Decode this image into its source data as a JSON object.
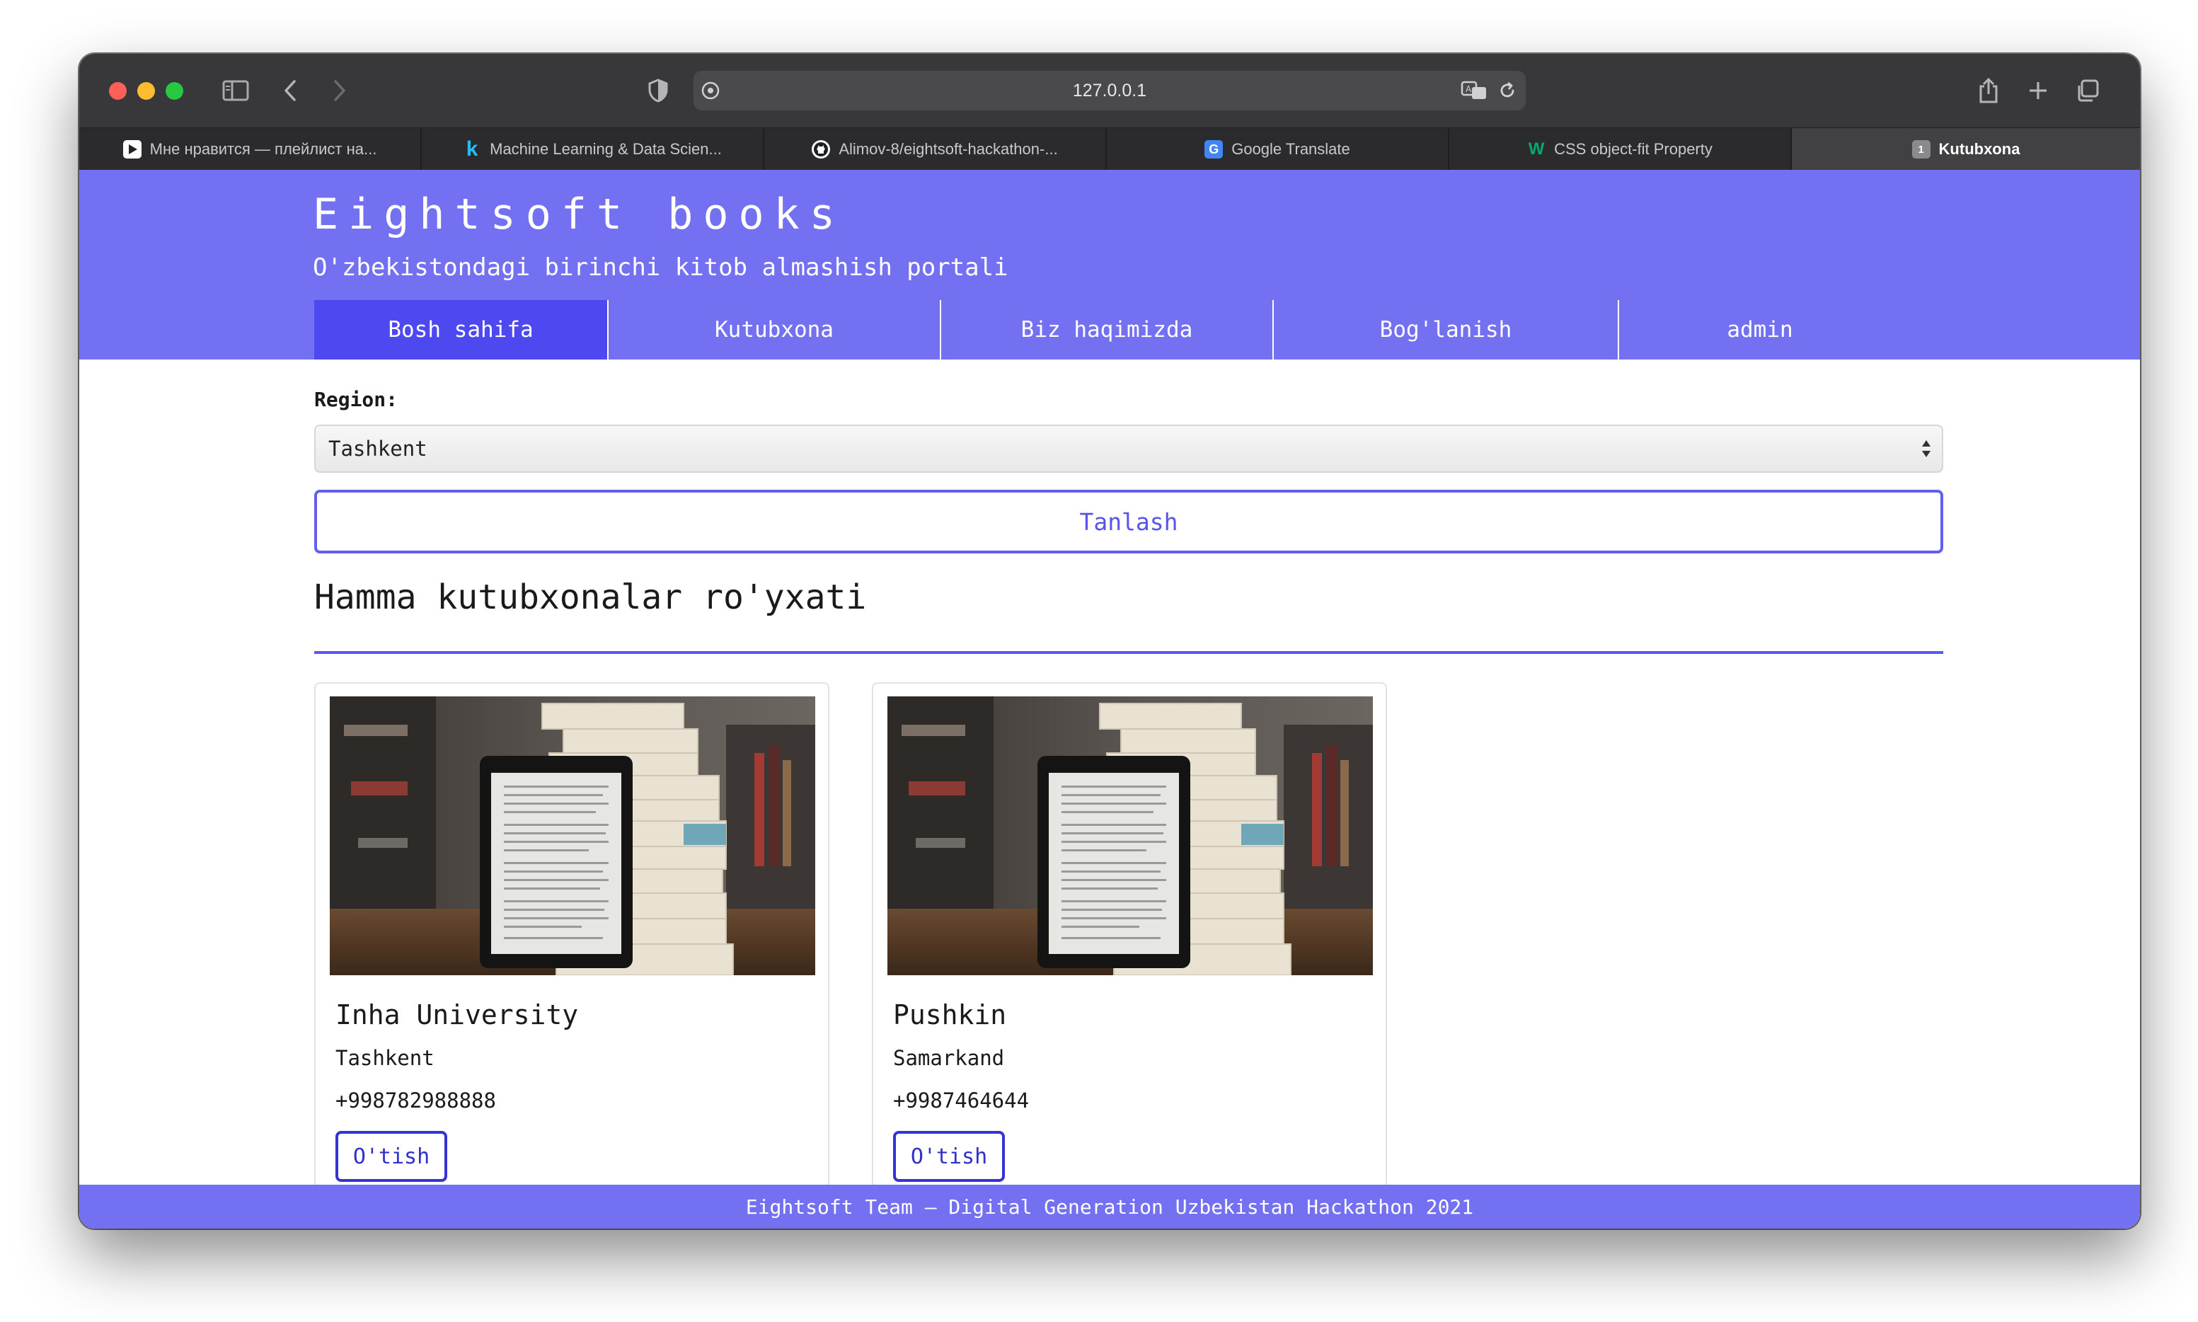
{
  "browser": {
    "url": "127.0.0.1",
    "tabs": [
      {
        "title": "Мне нравится — плейлист на...",
        "icon": "play-icon"
      },
      {
        "title": "Machine Learning & Data Scien...",
        "icon": "kaggle-icon"
      },
      {
        "title": "Alimov-8/eightsoft-hackathon-...",
        "icon": "github-icon"
      },
      {
        "title": "Google Translate",
        "icon": "google-translate-icon"
      },
      {
        "title": "CSS object-fit Property",
        "icon": "w3schools-icon"
      },
      {
        "title": "Kutubxona",
        "icon": "tab-number-icon",
        "badge": "1",
        "active": true
      }
    ]
  },
  "site": {
    "title": "Eightsoft books",
    "subtitle": "O'zbekistondagi birinchi kitob almashish portali",
    "nav": [
      {
        "label": "Bosh sahifa",
        "active": true
      },
      {
        "label": "Kutubxona"
      },
      {
        "label": "Biz haqimizda"
      },
      {
        "label": "Bog'lanish"
      },
      {
        "label": "admin"
      }
    ]
  },
  "filter": {
    "label": "Region:",
    "selected": "Tashkent",
    "button": "Tanlash"
  },
  "section_title": "Hamma kutubxonalar ro'yxati",
  "libraries": [
    {
      "name": "Inha University",
      "city": "Tashkent",
      "phone": "+998782988888",
      "button": "O'tish"
    },
    {
      "name": "Pushkin",
      "city": "Samarkand",
      "phone": "+9987464644",
      "button": "O'tish"
    }
  ],
  "footer": "Eightsoft Team — Digital Generation Uzbekistan Hackathon 2021",
  "colors": {
    "brand": "#7370f2",
    "nav_active": "#4d48f0",
    "button_border": "#625ef0",
    "card_button": "#3333d6"
  }
}
